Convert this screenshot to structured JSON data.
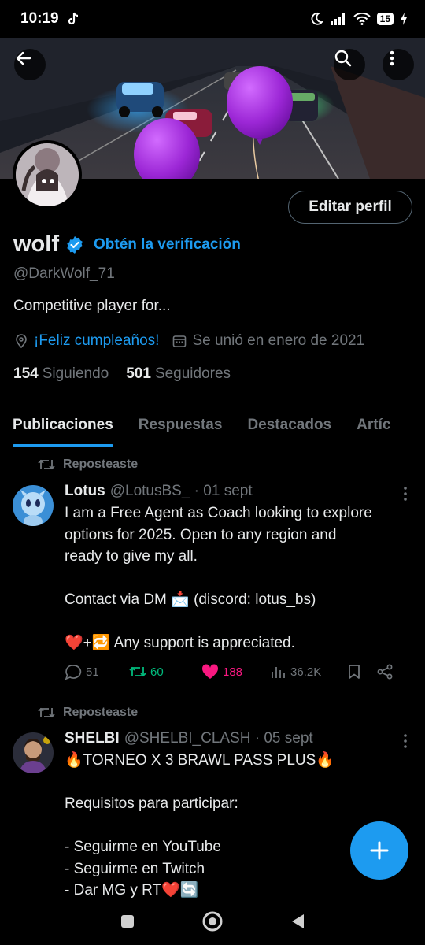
{
  "status_bar": {
    "time": "10:19",
    "battery": "15",
    "icons": [
      "tiktok-icon",
      "moon-icon",
      "signal-icon",
      "wifi-icon",
      "battery-icon",
      "charging-icon"
    ]
  },
  "header": {
    "back_icon": "arrow-left-icon",
    "search_icon": "search-icon",
    "more_icon": "more-vertical-icon"
  },
  "profile": {
    "edit_button": "Editar perfil",
    "name": "wolf",
    "verify_link": "Obtén la verificación",
    "handle": "@DarkWolf_71",
    "bio": "Competitive player for...",
    "birthday": "¡Feliz cumpleaños!",
    "joined": "Se unió en enero de 2021",
    "following_count": "154",
    "following_label": "Siguiendo",
    "followers_count": "501",
    "followers_label": "Seguidores"
  },
  "tabs": [
    {
      "label": "Publicaciones",
      "active": true
    },
    {
      "label": "Respuestas",
      "active": false
    },
    {
      "label": "Destacados",
      "active": false
    },
    {
      "label": "Artíc",
      "active": false
    }
  ],
  "posts": [
    {
      "repost_label": "Reposteaste",
      "name": "Lotus",
      "handle": "@LotusBS_ · 01 sept",
      "text": "I am a Free Agent as Coach looking to explore\noptions for 2025. Open to any region and\nready to give my all.\n\nContact via DM 📩 (discord: lotus_bs)\n\n❤️+🔁 Any support is appreciated.",
      "replies": "51",
      "reposts": "60",
      "likes": "188",
      "views": "36.2K"
    },
    {
      "repost_label": "Reposteaste",
      "name": "SHELBI",
      "handle": "@SHELBI_CLASH · 05 sept",
      "text": "🔥TORNEO X 3 BRAWL PASS PLUS🔥\n\nRequisitos para participar:\n\n- Seguirme en YouTube\n- Seguirme en Twitch\n- Dar MG y RT❤️🔄"
    }
  ],
  "colors": {
    "accent": "#1d9bf0",
    "repost_active": "#00ba7c",
    "like_active": "#f91880",
    "muted": "#71767b",
    "text": "#e7e9ea",
    "divider": "#2f3336"
  }
}
